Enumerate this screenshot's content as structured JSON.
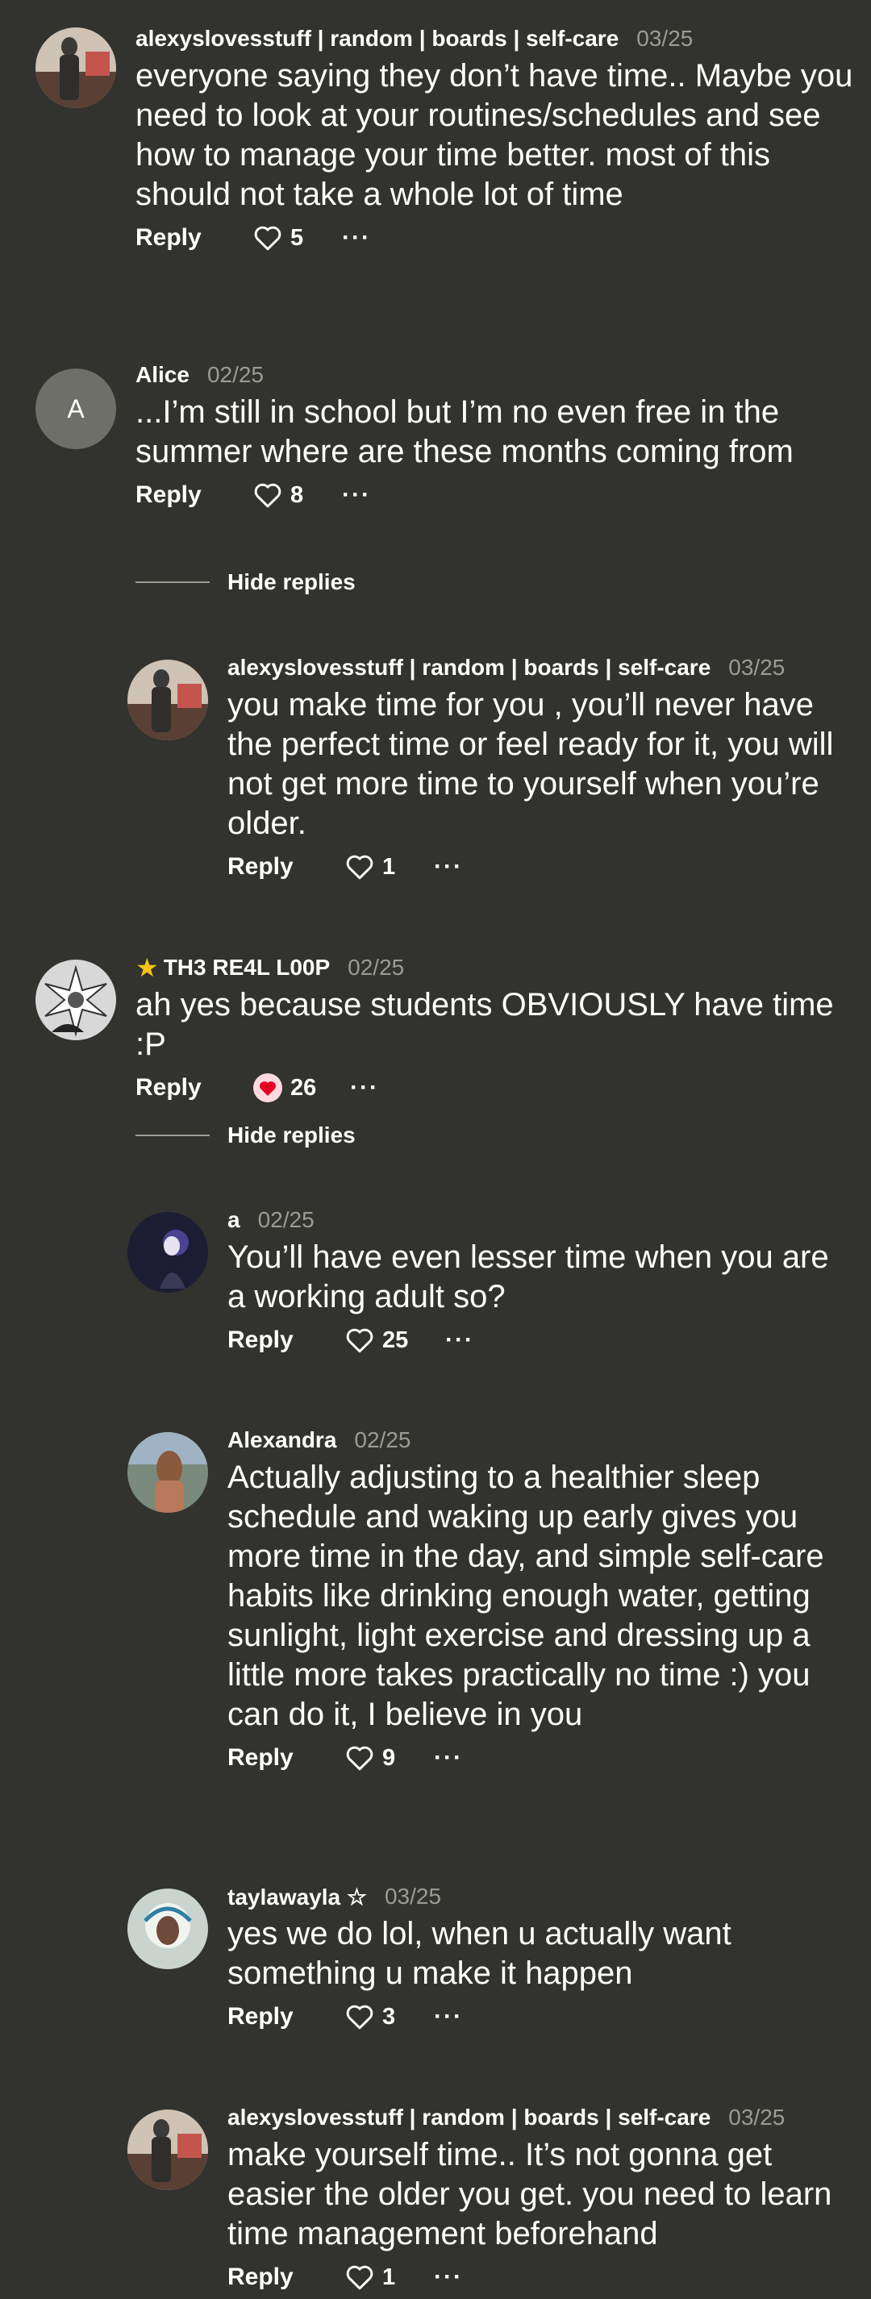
{
  "comments": [
    {
      "author": "alexyslovesstuff | random | boards | self-care",
      "date": "03/25",
      "text": "everyone saying they don’t have time.. Maybe you need to look at your routines/schedules and see how to manage your time better. most of this should not take a whole lot of time",
      "reply_label": "Reply",
      "likes": "5",
      "liked": false,
      "more": "···",
      "avatar": "photo-avatar"
    },
    {
      "author": "Alice",
      "date": "02/25",
      "text": "...I’m still in school but I’m no even free in the summer where are these months coming from",
      "reply_label": "Reply",
      "likes": "8",
      "liked": false,
      "more": "···",
      "avatar_letter": "A",
      "hide_replies": "Hide replies"
    },
    {
      "author": "alexyslovesstuff | random | boards | self-care",
      "date": "03/25",
      "text": "you make time for you , you’ll never have the perfect time or feel ready for it, you will not get more time to yourself when you’re older.",
      "reply_label": "Reply",
      "likes": "1",
      "liked": false,
      "more": "···",
      "avatar": "photo-avatar"
    },
    {
      "author": "TH3 RE4L L00P",
      "author_badge": "★",
      "date": "02/25",
      "text": "ah yes because students OBVIOUSLY have time :P",
      "reply_label": "Reply",
      "likes": "26",
      "liked": true,
      "more": "···",
      "avatar": "sketch-avatar",
      "hide_replies": "Hide replies"
    },
    {
      "author": "a",
      "date": "02/25",
      "text": "You’ll have even lesser time when you are a working adult so?",
      "reply_label": "Reply",
      "likes": "25",
      "liked": false,
      "more": "···",
      "avatar": "photo-avatar"
    },
    {
      "author": "Alexandra",
      "date": "02/25",
      "text": "Actually adjusting to a healthier sleep schedule and waking up early gives you more time in the day, and simple self-care habits like drinking enough water, getting sunlight, light exercise and dressing up a little more takes practically no time :) you can do it, I believe in you",
      "reply_label": "Reply",
      "likes": "9",
      "liked": false,
      "more": "···",
      "avatar": "photo-avatar"
    },
    {
      "author": "taylawayla ☆",
      "date": "03/25",
      "text": "yes we do lol, when u actually want something u make it happen",
      "reply_label": "Reply",
      "likes": "3",
      "liked": false,
      "more": "···",
      "avatar": "photo-avatar"
    },
    {
      "author": "alexyslovesstuff | random | boards | self-care",
      "date": "03/25",
      "text": "make yourself time.. It’s not gonna get easier the older you get. you need to learn time management beforehand",
      "reply_label": "Reply",
      "likes": "1",
      "liked": false,
      "more": "···",
      "avatar": "photo-avatar"
    }
  ],
  "colors": {
    "background": "#32322e",
    "text": "#ffffff",
    "muted": "#9c9c95",
    "heart_liked": "#e60023"
  },
  "icons": [
    "heart-outline-icon",
    "heart-filled-icon",
    "more-options-icon",
    "star-icon"
  ]
}
